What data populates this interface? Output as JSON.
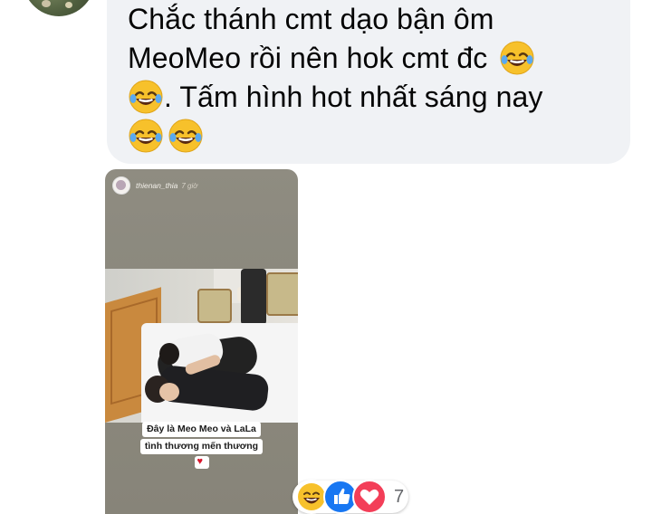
{
  "comment": {
    "lines": [
      {
        "text": "Chắc thánh cmt dạo bận ôm"
      },
      {
        "text": "MeoMeo rồi nên hok cmt đc"
      },
      {
        "text": ". Tấm hình hot nhất sáng nay"
      }
    ],
    "emoji": "rolling-on-floor-laughing"
  },
  "story": {
    "username": "thienan_thia",
    "time": "7 giờ",
    "caption_line1": "Đây là Meo Meo và LaLa",
    "caption_line2": "tình thương mến thương",
    "caption_heart": "♥"
  },
  "reactions": {
    "types": [
      "haha",
      "like",
      "love"
    ],
    "count": "7"
  }
}
